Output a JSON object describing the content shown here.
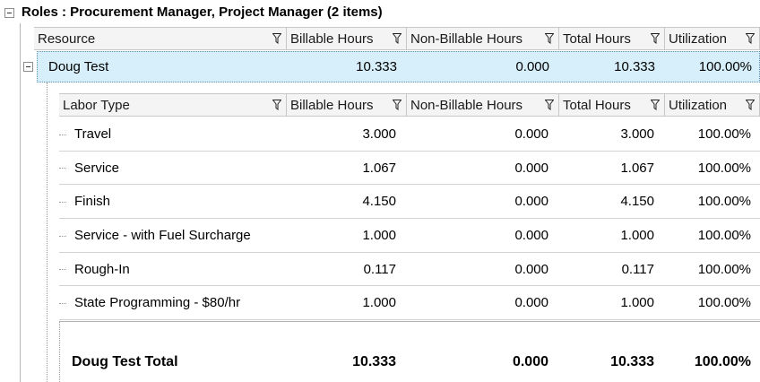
{
  "group": {
    "title": "Roles : Procurement Manager, Project Manager (2 items)"
  },
  "master_header": {
    "columns": [
      "Resource",
      "Billable Hours",
      "Non-Billable Hours",
      "Total Hours",
      "Utilization"
    ]
  },
  "master_row": {
    "resource": "Doug Test",
    "billable": "10.333",
    "non_billable": "0.000",
    "total": "10.333",
    "utilization": "100.00%"
  },
  "detail_header": {
    "columns": [
      "Labor Type",
      "Billable Hours",
      "Non-Billable Hours",
      "Total Hours",
      "Utilization"
    ]
  },
  "detail_rows": [
    {
      "labor_type": "Travel",
      "billable": "3.000",
      "non_billable": "0.000",
      "total": "3.000",
      "utilization": "100.00%"
    },
    {
      "labor_type": "Service",
      "billable": "1.067",
      "non_billable": "0.000",
      "total": "1.067",
      "utilization": "100.00%"
    },
    {
      "labor_type": "Finish",
      "billable": "4.150",
      "non_billable": "0.000",
      "total": "4.150",
      "utilization": "100.00%"
    },
    {
      "labor_type": "Service - with Fuel Surcharge",
      "billable": "1.000",
      "non_billable": "0.000",
      "total": "1.000",
      "utilization": "100.00%"
    },
    {
      "labor_type": "Rough-In",
      "billable": "0.117",
      "non_billable": "0.000",
      "total": "0.117",
      "utilization": "100.00%"
    },
    {
      "labor_type": "State Programming - $80/hr",
      "billable": "1.000",
      "non_billable": "0.000",
      "total": "1.000",
      "utilization": "100.00%"
    }
  ],
  "summary": {
    "label": "Doug Test Total",
    "billable": "10.333",
    "non_billable": "0.000",
    "total": "10.333",
    "utilization": "100.00%"
  },
  "icons": {
    "filter": "filter-funnel-icon",
    "collapse": "minus-box-icon"
  },
  "colors": {
    "selected_row": "#d7effa",
    "header_bg": "#f4f4f4"
  }
}
